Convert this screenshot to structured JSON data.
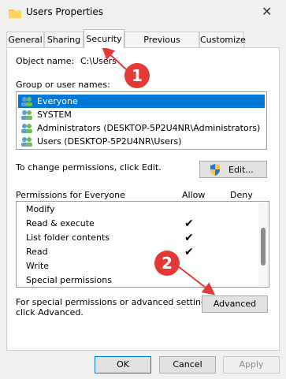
{
  "window": {
    "title": "Users Properties",
    "close_glyph": "✕"
  },
  "tabs": [
    {
      "label": "General"
    },
    {
      "label": "Sharing"
    },
    {
      "label": "Security"
    },
    {
      "label": "Previous Versions"
    },
    {
      "label": "Customize"
    }
  ],
  "security": {
    "object_name_label": "Object name:",
    "object_name_value": "C:\\Users",
    "group_label": "Group or user names:",
    "users": [
      {
        "label": "Everyone",
        "selected": true
      },
      {
        "label": "SYSTEM",
        "selected": false
      },
      {
        "label": "Administrators (DESKTOP-5P2U4NR\\Administrators)",
        "selected": false
      },
      {
        "label": "Users (DESKTOP-5P2U4NR\\Users)",
        "selected": false
      }
    ],
    "change_text": "To change permissions, click Edit.",
    "edit_label": "Edit...",
    "perm_label": "Permissions for Everyone",
    "allow_label": "Allow",
    "deny_label": "Deny",
    "permissions": [
      {
        "label": "Modify",
        "allow": false
      },
      {
        "label": "Read & execute",
        "allow": true
      },
      {
        "label": "List folder contents",
        "allow": true
      },
      {
        "label": "Read",
        "allow": true
      },
      {
        "label": "Write",
        "allow": false
      },
      {
        "label": "Special permissions",
        "allow": false
      }
    ],
    "special_text_1": "For special permissions or advanced settings,",
    "special_text_2": "click Advanced.",
    "advanced_label": "Advanced"
  },
  "footer": {
    "ok": "OK",
    "cancel": "Cancel",
    "apply": "Apply"
  },
  "annotations": [
    {
      "label": "1"
    },
    {
      "label": "2"
    }
  ],
  "colors": {
    "selection": "#0078d7",
    "annotation_red": "#e53935"
  }
}
